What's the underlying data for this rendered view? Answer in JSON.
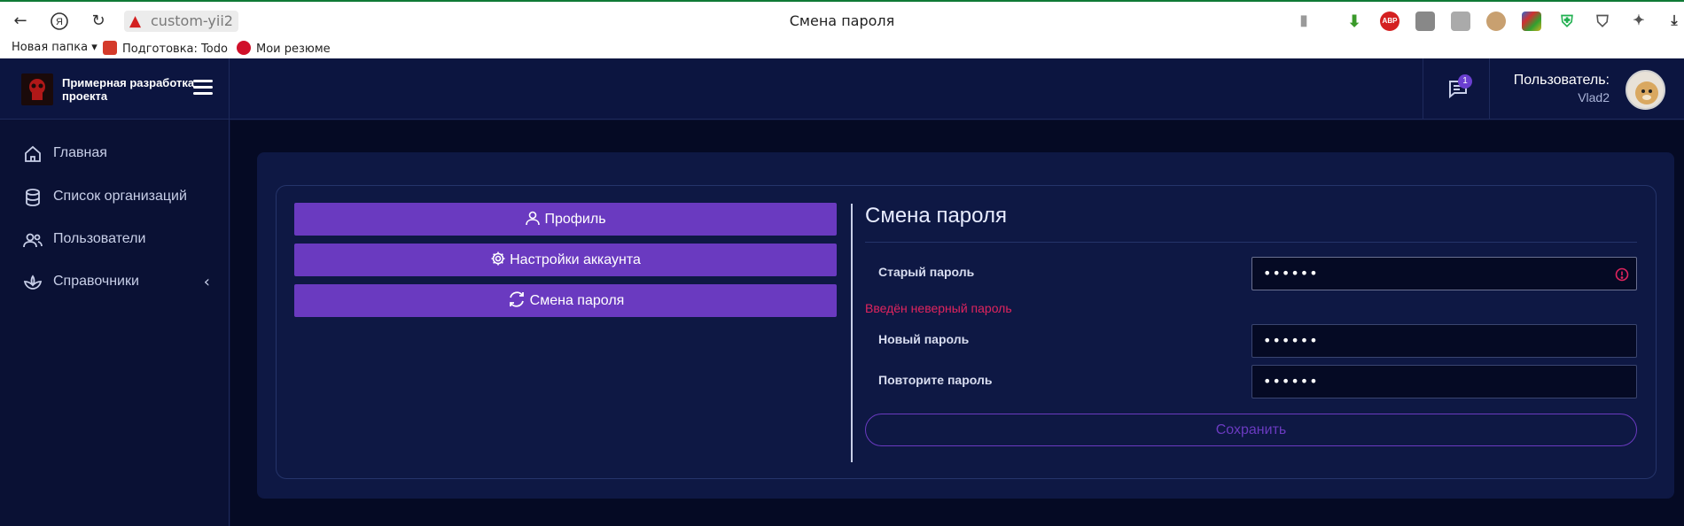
{
  "browser": {
    "address": "custom-yii2",
    "tab_title": "Смена пароля",
    "bookmarks": [
      {
        "label": "Новая папка ▾"
      },
      {
        "label": "Подготовка: Todo"
      },
      {
        "label": "Мои резюме"
      }
    ],
    "extensions": [
      "bookmark-icon",
      "download-icon",
      "abp-icon",
      "ext-dog-icon",
      "ext-gray-icon",
      "ext-pug-icon",
      "ext-grid-icon",
      "shield-check-icon",
      "shield-icon",
      "puzzle-icon",
      "download-arrow-icon"
    ],
    "abp_label": "ABP"
  },
  "header": {
    "brand": "Примерная разработка проекта",
    "chat_badge": "1",
    "user_label": "Пользователь:",
    "user_name": "Vlad2"
  },
  "sidebar": {
    "items": [
      {
        "label": "Главная",
        "icon": "home-icon"
      },
      {
        "label": "Список организаций",
        "icon": "database-icon"
      },
      {
        "label": "Пользователи",
        "icon": "users-icon"
      },
      {
        "label": "Справочники",
        "icon": "lotus-icon",
        "chevron": "‹"
      }
    ]
  },
  "menu": {
    "profile": "Профиль",
    "account_settings": "Настройки аккаунта",
    "change_password": "Смена пароля"
  },
  "form": {
    "title": "Смена пароля",
    "old_password_label": "Старый пароль",
    "old_password_value": "••••••",
    "error": "Введён неверный пароль",
    "new_password_label": "Новый пароль",
    "new_password_value": "••••••",
    "repeat_password_label": "Повторите пароль",
    "repeat_password_value": "••••••",
    "save": "Сохранить"
  },
  "colors": {
    "accent": "#6a3ac0",
    "error": "#e0245e",
    "background": "#0a1134"
  }
}
